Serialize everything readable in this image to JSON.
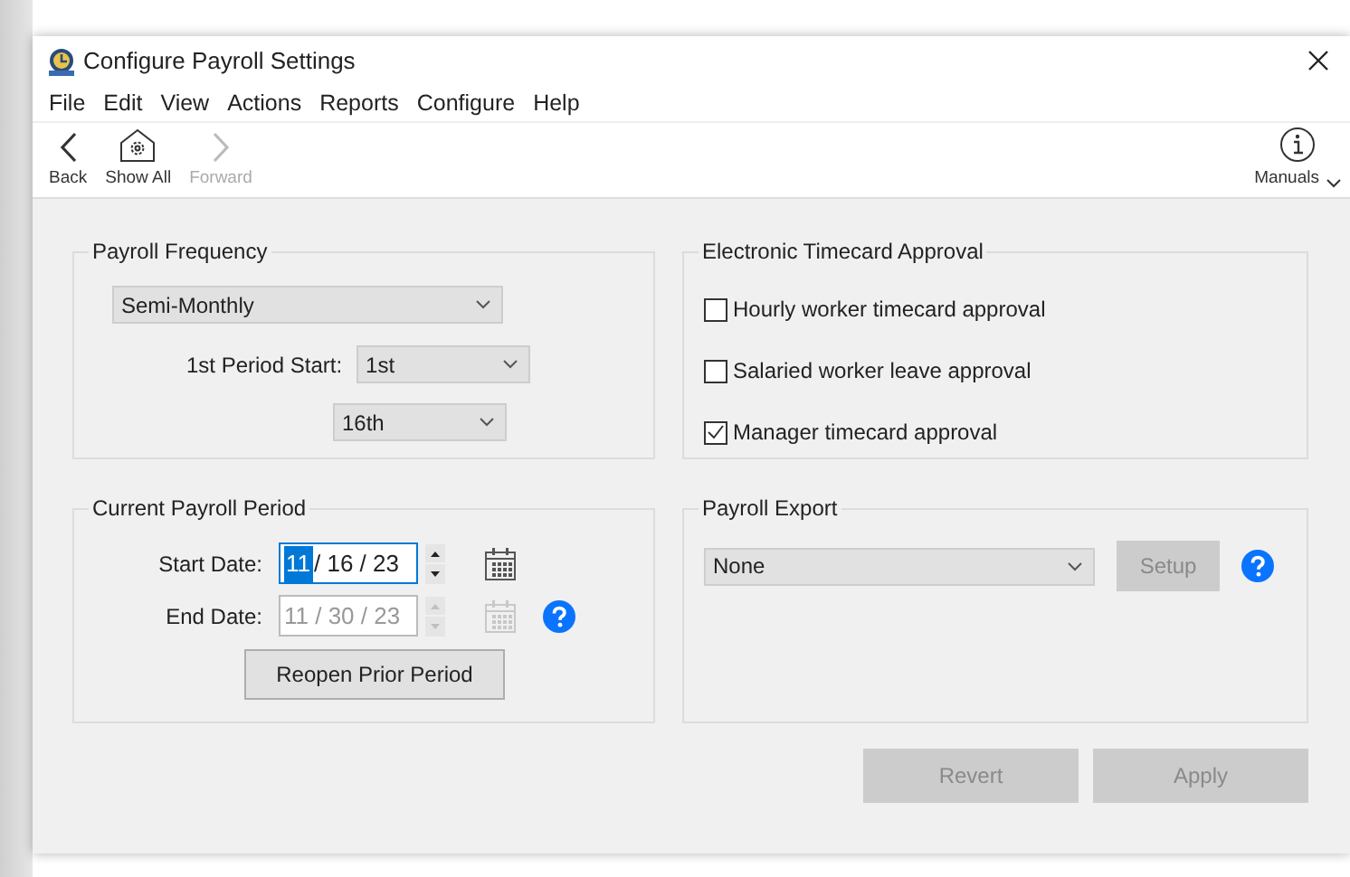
{
  "window": {
    "title": "Configure Payroll Settings"
  },
  "menu": [
    "File",
    "Edit",
    "View",
    "Actions",
    "Reports",
    "Configure",
    "Help"
  ],
  "toolbar": [
    {
      "kind": "back",
      "label": "Back",
      "disabled": false
    },
    {
      "kind": "home",
      "label": "Show All",
      "disabled": false
    },
    {
      "kind": "forward",
      "label": "Forward",
      "disabled": true
    }
  ],
  "manuals": {
    "label": "Manuals"
  },
  "payroll_frequency": {
    "title": "Payroll Frequency",
    "frequency": "Semi-Monthly",
    "period_start_label": "1st Period Start:",
    "first_start": "1st",
    "second_start": "16th"
  },
  "timecard_approval": {
    "title": "Electronic Timecard Approval",
    "options": [
      {
        "label": "Hourly worker timecard approval",
        "checked": false
      },
      {
        "label": "Salaried worker leave approval",
        "checked": false
      },
      {
        "label": "Manager timecard approval",
        "checked": true
      }
    ]
  },
  "current_period": {
    "title": "Current Payroll Period",
    "dates": [
      {
        "label": "Start Date:",
        "disabled": false,
        "help": false,
        "parts": [
          {
            "text": "11",
            "selected": true
          },
          {
            "text": "/ 16 / 23",
            "selected": false
          }
        ]
      },
      {
        "label": "End Date:",
        "disabled": true,
        "help": true,
        "parts": [
          {
            "text": "11 / 30 / 23",
            "selected": false
          }
        ]
      }
    ],
    "reopen_button": {
      "label": "Reopen Prior Period",
      "disabled": false
    }
  },
  "payroll_export": {
    "title": "Payroll Export",
    "value": "None",
    "setup_button": {
      "label": "Setup",
      "disabled": true
    }
  },
  "footer_buttons": [
    {
      "label": "Revert",
      "disabled": true
    },
    {
      "label": "Apply",
      "disabled": true
    }
  ]
}
